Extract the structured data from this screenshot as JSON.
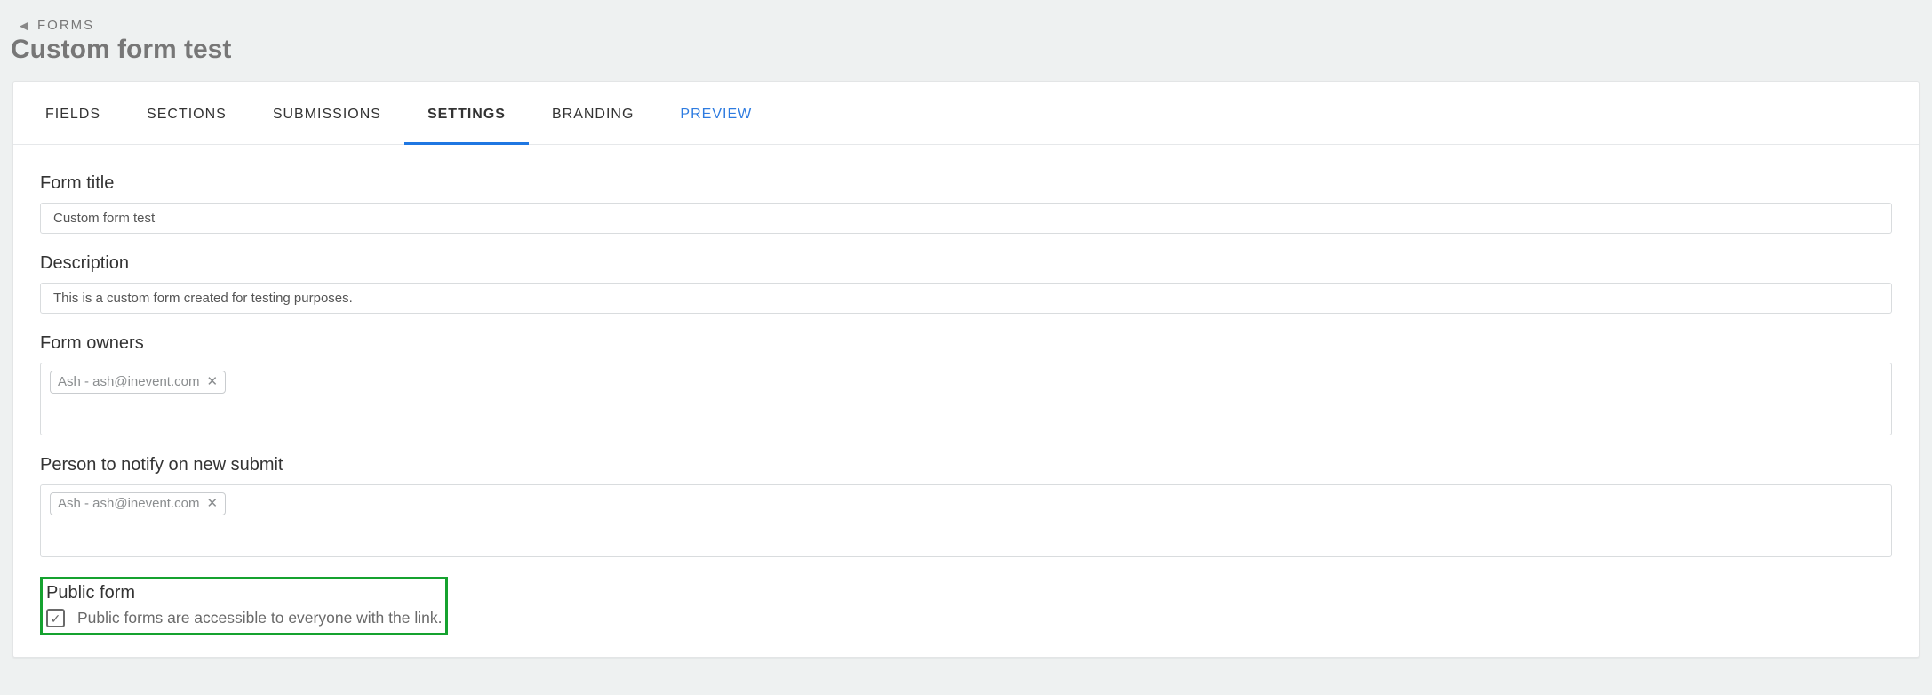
{
  "breadcrumb": {
    "label": "FORMS"
  },
  "page_title": "Custom form test",
  "tabs": {
    "fields": {
      "label": "FIELDS"
    },
    "sections": {
      "label": "SECTIONS"
    },
    "submissions": {
      "label": "SUBMISSIONS"
    },
    "settings": {
      "label": "SETTINGS"
    },
    "branding": {
      "label": "BRANDING"
    },
    "preview": {
      "label": "PREVIEW"
    }
  },
  "settings": {
    "form_title_label": "Form title",
    "form_title_value": "Custom form test",
    "description_label": "Description",
    "description_value": "This is a custom form created for testing purposes.",
    "owners_label": "Form owners",
    "owners_tag": "Ash - ash@inevent.com",
    "notify_label": "Person to notify on new submit",
    "notify_tag": "Ash - ash@inevent.com",
    "public_title": "Public form",
    "public_help": "Public forms are accessible to everyone with the link.",
    "public_checked": true
  }
}
